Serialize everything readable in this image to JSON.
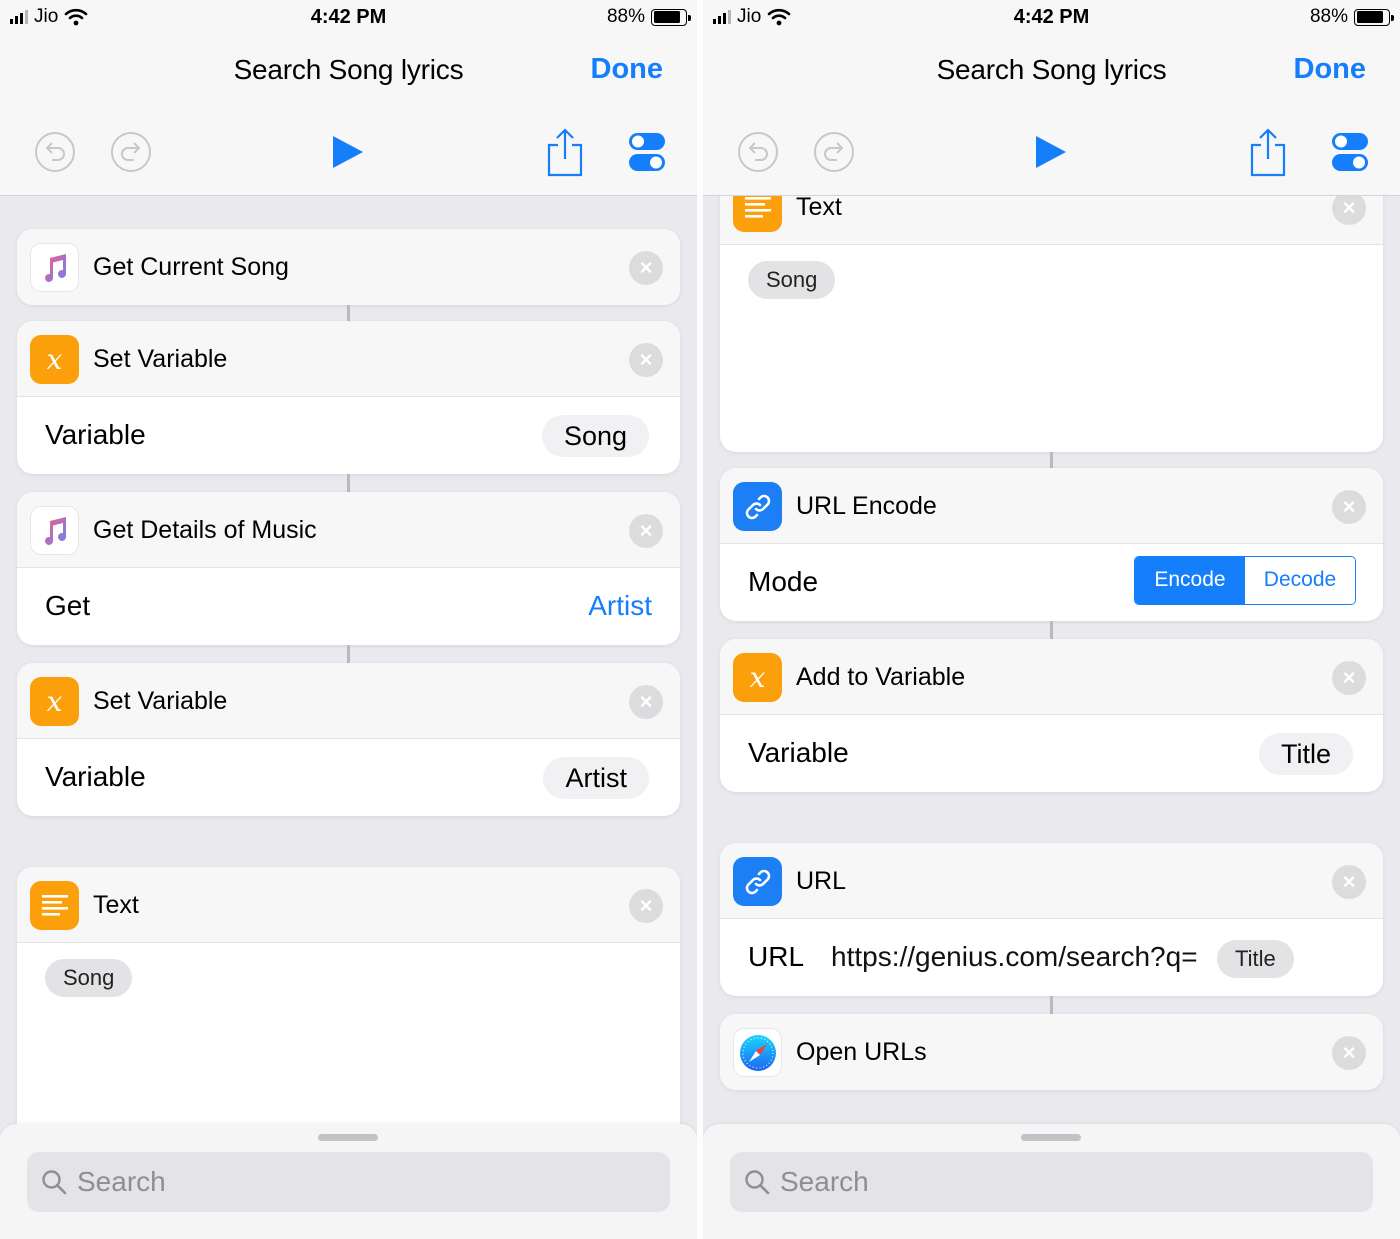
{
  "status": {
    "carrier": "Jio",
    "time": "4:42 PM",
    "battery": "88%"
  },
  "nav": {
    "title": "Search Song lyrics",
    "done": "Done"
  },
  "toolbar": [
    "undo-icon",
    "redo-icon",
    "play-icon",
    "share-icon",
    "settings-toggle-icon"
  ],
  "left": {
    "cards": [
      {
        "title": "Get Current Song",
        "icon": "music-note-icon"
      },
      {
        "title": "Set Variable",
        "icon": "variable-icon",
        "row": {
          "label": "Variable",
          "value": "Song"
        }
      },
      {
        "title": "Get Details of Music",
        "icon": "music-note-icon",
        "row": {
          "label": "Get",
          "value": "Artist"
        }
      },
      {
        "title": "Set Variable",
        "icon": "variable-icon",
        "row": {
          "label": "Variable",
          "value": "Artist"
        }
      },
      {
        "title": "Text",
        "icon": "text-icon",
        "token": "Song"
      }
    ]
  },
  "right": {
    "cards": [
      {
        "title": "Text",
        "icon": "text-icon",
        "token": "Song"
      },
      {
        "title": "URL Encode",
        "icon": "link-icon",
        "row": {
          "label": "Mode",
          "options": [
            "Encode",
            "Decode"
          ],
          "selected": "Encode"
        }
      },
      {
        "title": "Add to Variable",
        "icon": "variable-icon",
        "row": {
          "label": "Variable",
          "value": "Title"
        }
      },
      {
        "title": "URL",
        "icon": "link-icon",
        "row": {
          "label": "URL",
          "value": "https://genius.com/search?q=",
          "token": "Title"
        }
      },
      {
        "title": "Open URLs",
        "icon": "safari-icon"
      }
    ]
  },
  "search": {
    "placeholder": "Search"
  },
  "colors": {
    "accent": "#147efb",
    "orange": "#fb9f0a",
    "background": "#e9e9ee"
  }
}
